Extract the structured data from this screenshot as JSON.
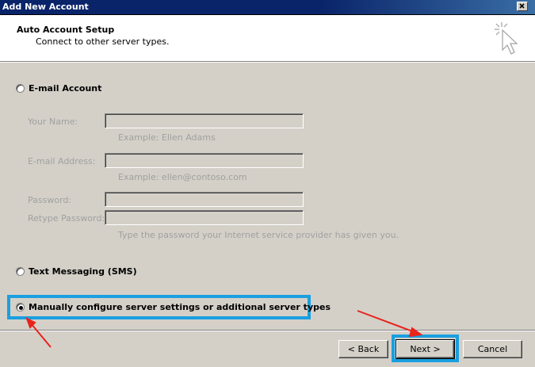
{
  "window": {
    "title": "Add New Account"
  },
  "header": {
    "title": "Auto Account Setup",
    "subtitle": "Connect to other server types."
  },
  "options": {
    "email": {
      "label": "E-mail Account",
      "selected": false
    },
    "sms": {
      "label": "Text Messaging (SMS)",
      "selected": false
    },
    "manual": {
      "label": "Manually configure server settings or additional server types",
      "selected": true
    }
  },
  "email_form": {
    "name_label": "Your Name:",
    "name_value": "",
    "name_hint": "Example: Ellen Adams",
    "email_label": "E-mail Address:",
    "email_value": "",
    "email_hint": "Example: ellen@contoso.com",
    "password_label": "Password:",
    "password_value": "",
    "retype_label": "Retype Password:",
    "retype_value": "",
    "password_hint": "Type the password your Internet service provider has given you."
  },
  "buttons": {
    "back": "< Back",
    "next": "Next >",
    "cancel": "Cancel"
  },
  "colors": {
    "highlight": "#1a9fe0",
    "arrow": "#e8241c",
    "titlebar": "#0a246a"
  }
}
